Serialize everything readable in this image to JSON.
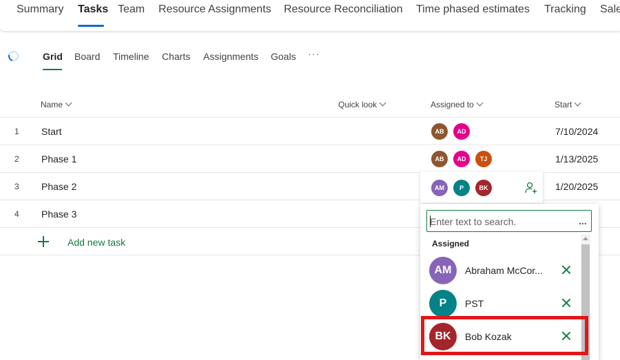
{
  "top_tabs": [
    {
      "label": "Summary"
    },
    {
      "label": "Tasks"
    },
    {
      "label": "Team"
    },
    {
      "label": "Resource Assignments"
    },
    {
      "label": "Resource Reconciliation"
    },
    {
      "label": "Time phased estimates"
    },
    {
      "label": "Tracking"
    },
    {
      "label": "Sale"
    }
  ],
  "view_tabs": [
    {
      "label": "Grid"
    },
    {
      "label": "Board"
    },
    {
      "label": "Timeline"
    },
    {
      "label": "Charts"
    },
    {
      "label": "Assignments"
    },
    {
      "label": "Goals"
    }
  ],
  "view_more": "···",
  "columns": {
    "name": "Name",
    "quick_look": "Quick look",
    "assigned_to": "Assigned to",
    "start": "Start"
  },
  "rows": [
    {
      "num": "1",
      "name": "Start",
      "start": "7/10/2024",
      "assignees": [
        {
          "initials": "AB",
          "color": "#8e562e"
        },
        {
          "initials": "AD",
          "color": "#e3008c"
        }
      ]
    },
    {
      "num": "2",
      "name": "Phase 1",
      "start": "1/13/2025",
      "assignees": [
        {
          "initials": "AB",
          "color": "#8e562e"
        },
        {
          "initials": "AD",
          "color": "#e3008c"
        },
        {
          "initials": "TJ",
          "color": "#ca5010"
        }
      ]
    },
    {
      "num": "3",
      "name": "Phase 2",
      "start": "1/20/2025",
      "assignees": [
        {
          "initials": "AM",
          "color": "#8764b8"
        },
        {
          "initials": "P",
          "color": "#038387"
        },
        {
          "initials": "BK",
          "color": "#a4262c"
        }
      ]
    },
    {
      "num": "4",
      "name": "Phase 3",
      "start": "",
      "assignees": []
    }
  ],
  "add_task": {
    "label": "Add new task"
  },
  "assign_panel": {
    "search_placeholder": "Enter text to search.",
    "more": "...",
    "section_label": "Assigned",
    "people": [
      {
        "initials": "AM",
        "name": "Abraham McCor...",
        "color": "#8764b8"
      },
      {
        "initials": "P",
        "name": "PST",
        "color": "#038387"
      },
      {
        "initials": "BK",
        "name": "Bob Kozak",
        "color": "#a4262c"
      }
    ]
  },
  "colors": {
    "accent_blue": "#0f6cbd",
    "accent_green": "#107c41",
    "highlight_red": "#e0171a"
  }
}
